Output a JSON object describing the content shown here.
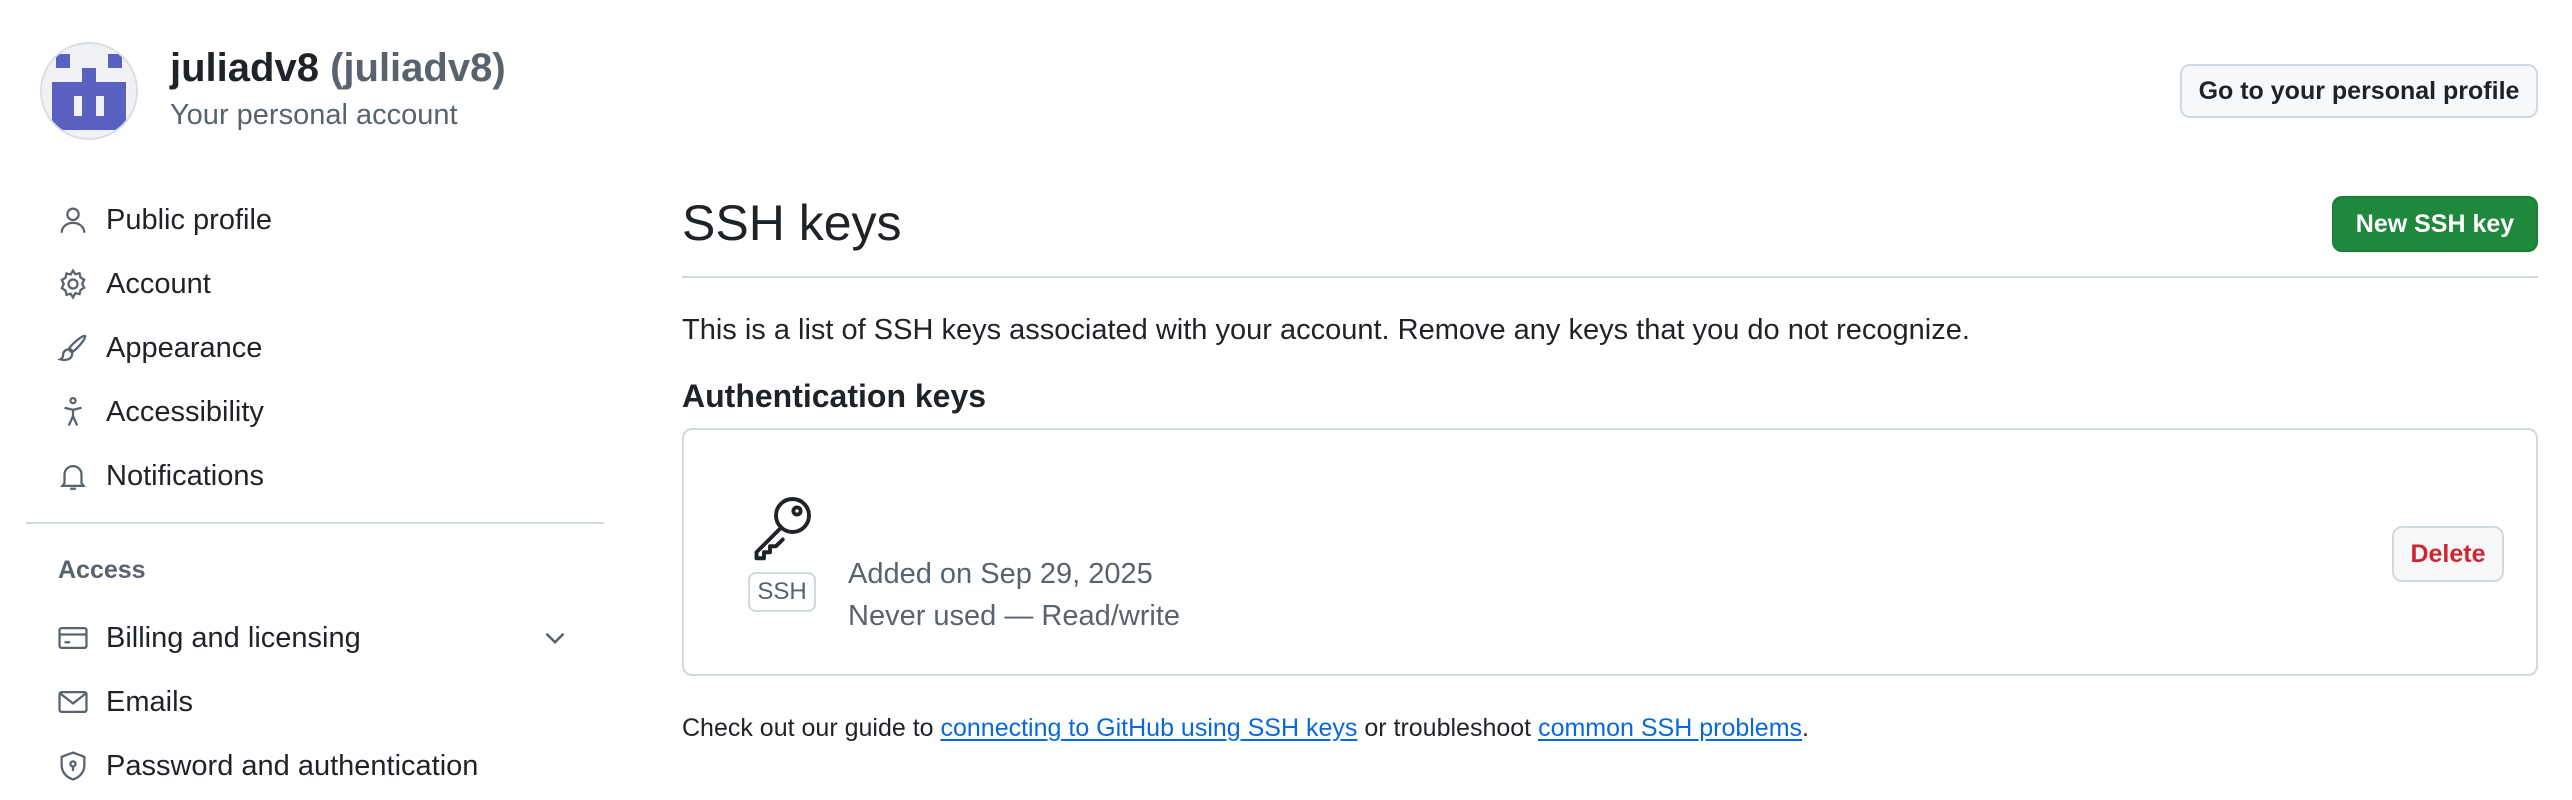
{
  "header": {
    "display_name": "juliadv8",
    "login": "(juliadv8)",
    "subtitle": "Your personal account",
    "profile_button": "Go to your personal profile"
  },
  "sidebar": {
    "items": [
      {
        "label": "Public profile",
        "icon": "person-icon"
      },
      {
        "label": "Account",
        "icon": "gear-icon"
      },
      {
        "label": "Appearance",
        "icon": "paintbrush-icon"
      },
      {
        "label": "Accessibility",
        "icon": "accessibility-icon"
      },
      {
        "label": "Notifications",
        "icon": "bell-icon"
      }
    ],
    "access_heading": "Access",
    "access_items": [
      {
        "label": "Billing and licensing",
        "icon": "credit-card-icon",
        "expandable": true
      },
      {
        "label": "Emails",
        "icon": "mail-icon"
      },
      {
        "label": "Password and authentication",
        "icon": "shield-lock-icon"
      }
    ]
  },
  "main": {
    "title": "SSH keys",
    "new_button": "New SSH key",
    "intro": "This is a list of SSH keys associated with your account. Remove any keys that you do not recognize.",
    "section_heading": "Authentication keys",
    "keys": [
      {
        "badge": "SSH",
        "added": "Added on Sep 29, 2025",
        "usage": "Never used — Read/write",
        "delete_label": "Delete"
      }
    ],
    "footer": {
      "prefix": "Check out our guide to ",
      "link1": "connecting to GitHub using SSH keys",
      "middle": " or troubleshoot ",
      "link2": "common SSH problems",
      "suffix": "."
    }
  },
  "colors": {
    "primary_button": "#1f883d",
    "danger": "#d1242f",
    "link": "#0969da",
    "avatar": "#5a60c0"
  }
}
